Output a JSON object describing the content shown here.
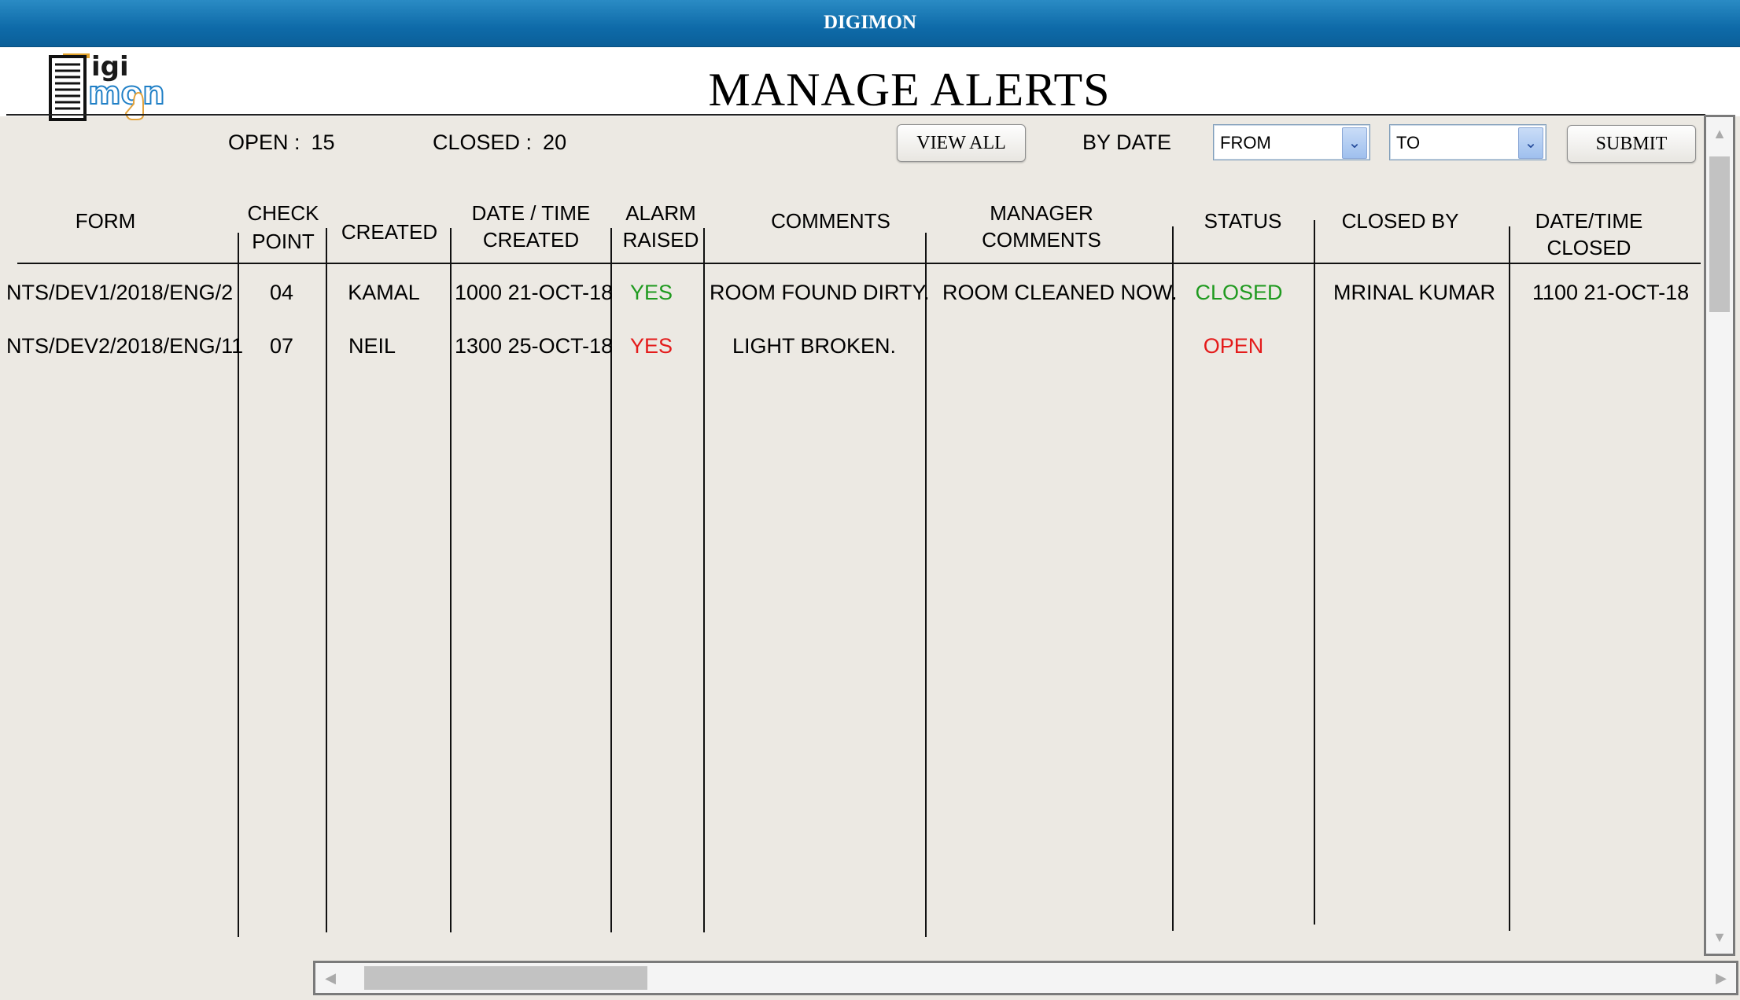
{
  "window": {
    "title": "DIGIMON"
  },
  "logo": {
    "text": "DIGIMON"
  },
  "page": {
    "title": "MANAGE ALERTS"
  },
  "summary": {
    "open_label": "OPEN :",
    "open_value": "15",
    "closed_label": "CLOSED :",
    "closed_value": "20"
  },
  "toolbar": {
    "view_all_label": "VIEW ALL",
    "by_date_label": "BY DATE",
    "from_value": "FROM",
    "to_value": "TO",
    "submit_label": "SUBMIT"
  },
  "table": {
    "headers": {
      "form": "FORM",
      "check_1": "CHECK",
      "check_2": "POINT",
      "created": "CREATED",
      "dt_created_1": "DATE / TIME",
      "dt_created_2": "CREATED",
      "alarm_1": "ALARM",
      "alarm_2": "RAISED",
      "comments": "COMMENTS",
      "mgr_1": "MANAGER",
      "mgr_2": "COMMENTS",
      "status": "STATUS",
      "closed_by": "CLOSED BY",
      "dt_closed_1": "DATE/TIME",
      "dt_closed_2": "CLOSED"
    },
    "rows": [
      {
        "form": "NTS/DEV1/2018/ENG/2",
        "check_point": "04",
        "created": "KAMAL",
        "date_created": "1000 21-OCT-18",
        "alarm": "YES",
        "comments": "ROOM FOUND DIRTY.",
        "manager_comments": "ROOM CLEANED NOW.",
        "status": "CLOSED",
        "closed_by": "MRINAL KUMAR",
        "date_closed": "1100 21-OCT-18"
      },
      {
        "form": "NTS/DEV2/2018/ENG/11",
        "check_point": "07",
        "created": "NEIL",
        "date_created": "1300 25-OCT-18",
        "alarm": "YES",
        "comments": "LIGHT BROKEN.",
        "manager_comments": "",
        "status": "OPEN",
        "closed_by": "",
        "date_closed": ""
      }
    ]
  },
  "colors": {
    "titlebar": "#0e6aa8",
    "status_closed": "#1f9a1f",
    "status_open": "#e41b1b",
    "alarm_yes": "#1f9a1f"
  }
}
